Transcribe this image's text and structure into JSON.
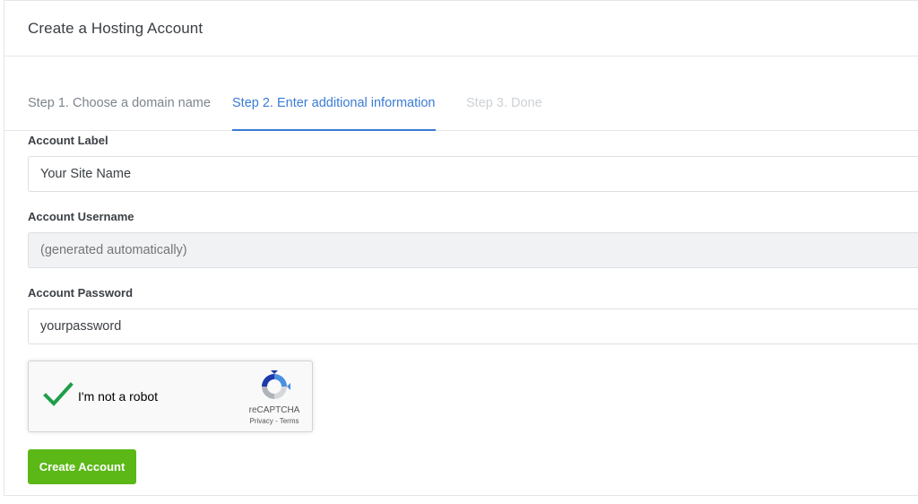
{
  "card": {
    "title": "Create a Hosting Account"
  },
  "tabs": [
    {
      "label": "Step 1. Choose a domain name",
      "state": "completed"
    },
    {
      "label": "Step 2. Enter additional information",
      "state": "active"
    },
    {
      "label": "Step 3. Done",
      "state": "disabled"
    }
  ],
  "form": {
    "account_label": {
      "label": "Account Label",
      "value": "Your Site Name"
    },
    "account_username": {
      "label": "Account Username",
      "placeholder": "(generated automatically)",
      "disabled": true
    },
    "account_password": {
      "label": "Account Password",
      "value": "yourpassword"
    }
  },
  "recaptcha": {
    "label": "I'm not a robot",
    "checked": true,
    "brand": "reCAPTCHA",
    "privacy_link": "Privacy",
    "separator": " - ",
    "terms_link": "Terms",
    "check_color": "#1e9e4a"
  },
  "submit": {
    "label": "Create Account",
    "color": "#5bb817"
  },
  "colors": {
    "active_tab": "#3a7bd5",
    "inactive_tab": "#7d848c",
    "disabled_tab": "#cdd1d5"
  }
}
